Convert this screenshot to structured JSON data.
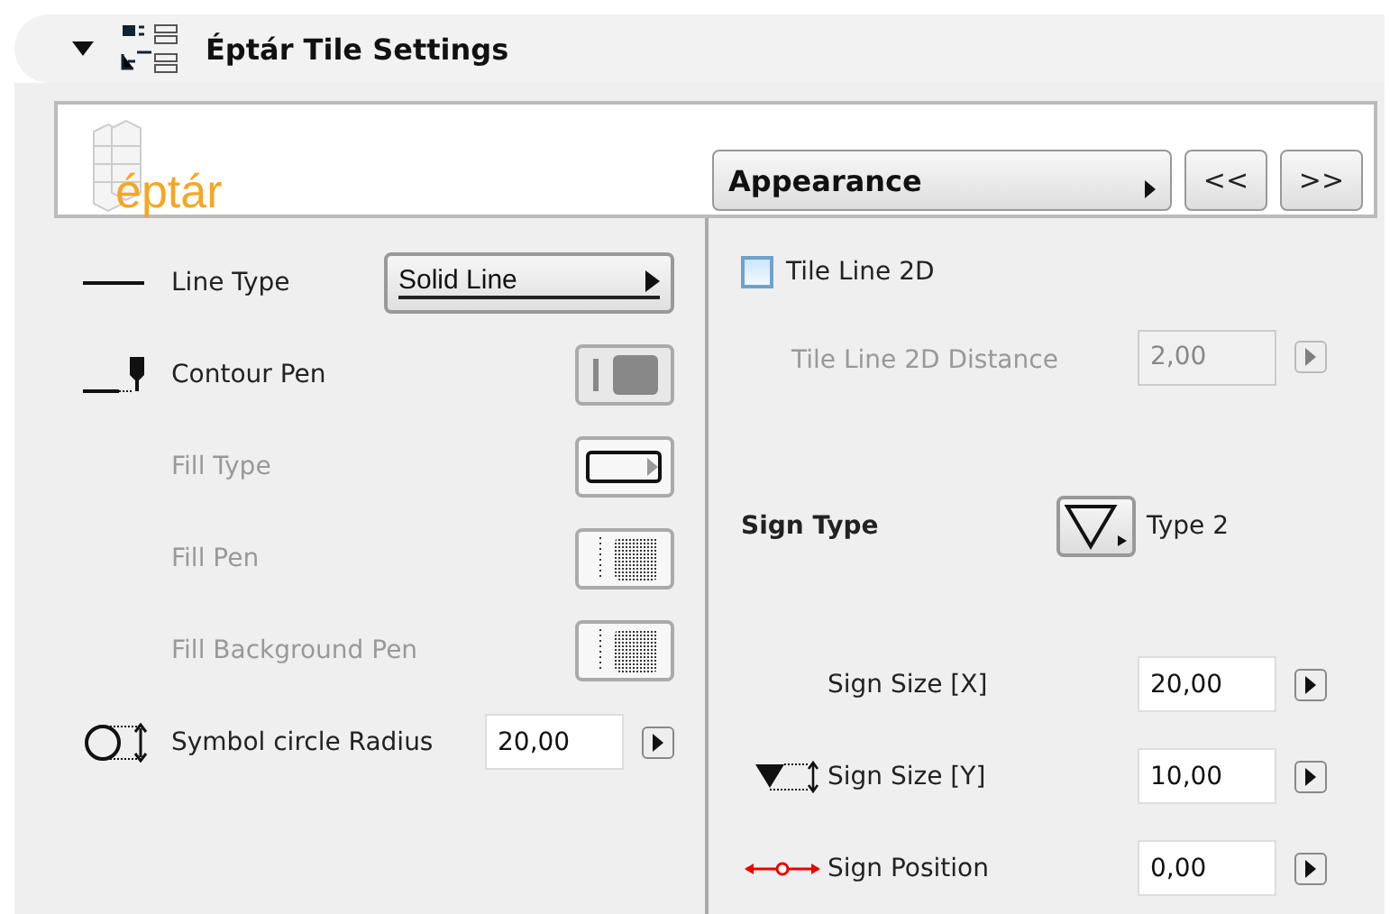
{
  "header": {
    "title": "Éptár Tile Settings",
    "expanded": true
  },
  "logo": {
    "text": "éptár"
  },
  "page_selector": {
    "label": "Appearance"
  },
  "nav_buttons": [
    "<<",
    ">>"
  ],
  "left_rows": [
    {
      "kind": "linetype",
      "label": "Line Type",
      "value": "Solid Line",
      "disabled": false
    },
    {
      "kind": "pen",
      "label": "Contour Pen",
      "disabled": false
    },
    {
      "kind": "filltype",
      "label": "Fill Type",
      "disabled": true
    },
    {
      "kind": "fillpen",
      "label": "Fill Pen",
      "disabled": true
    },
    {
      "kind": "fillpen",
      "label": "Fill Background Pen",
      "disabled": true
    },
    {
      "kind": "radius",
      "label": "Symbol circle Radius",
      "value": "20,00",
      "disabled": false
    }
  ],
  "tile_line": {
    "label": "Tile Line 2D",
    "checked": false
  },
  "distance": {
    "label": "Tile Line 2D Distance",
    "value": "2,00",
    "disabled": true
  },
  "sign_type": {
    "label": "Sign Type",
    "value": "Type 2"
  },
  "sign_rows": [
    {
      "kind": "plain",
      "label": "Sign Size [X]",
      "value": "20,00"
    },
    {
      "kind": "height",
      "label": "Sign Size [Y]",
      "value": "10,00"
    },
    {
      "kind": "position",
      "label": "Sign Position",
      "value": "0,00"
    }
  ]
}
